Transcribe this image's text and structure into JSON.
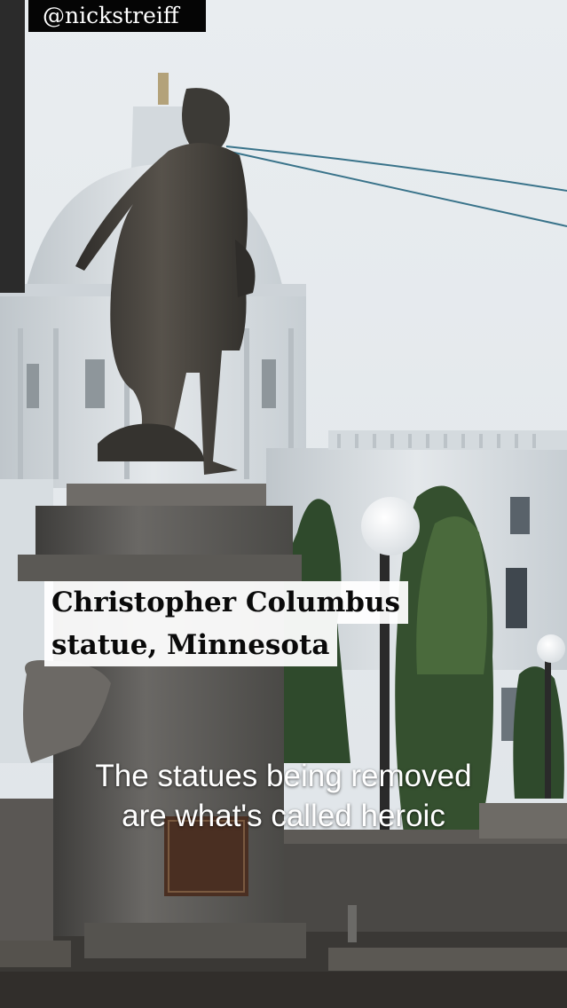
{
  "video": {
    "handle": "@nickstreiff",
    "lower_third": {
      "line1": "Christopher Columbus",
      "line2": "statue, Minnesota"
    },
    "caption": {
      "line1": "The statues being removed",
      "line2": "are what's called heroic"
    }
  }
}
